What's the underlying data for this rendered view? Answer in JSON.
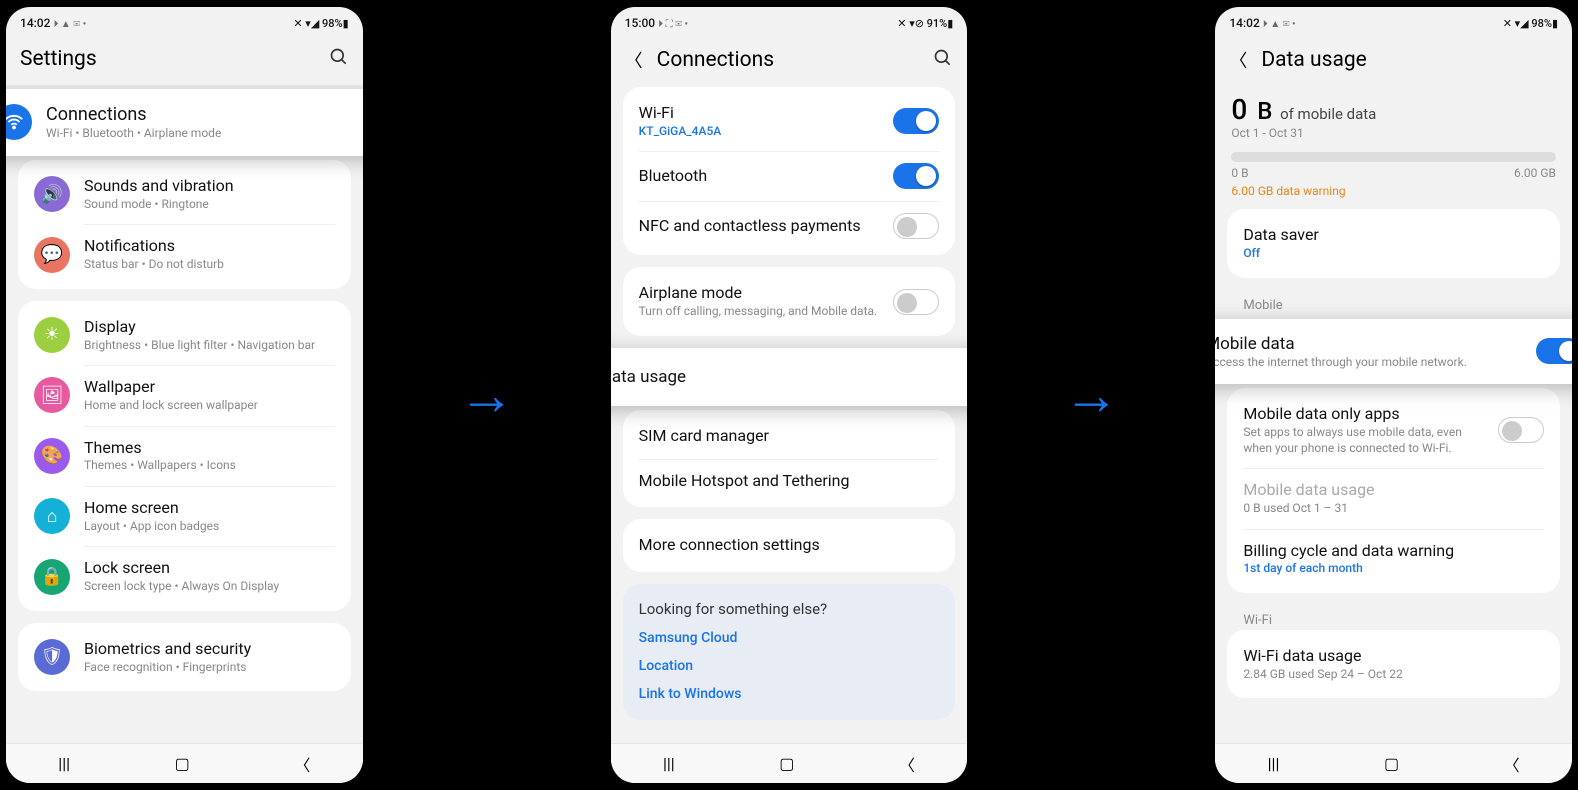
{
  "phone1": {
    "status": {
      "time": "14:02",
      "left_icons": "⏵ ▲ ✉ •",
      "right": "✕ ▾◢ 98%▮"
    },
    "header": {
      "title": "Settings"
    },
    "highlight": {
      "title": "Connections",
      "sub": "Wi-Fi  •  Bluetooth  •  Airplane mode"
    },
    "items": [
      {
        "title": "Sounds and vibration",
        "sub": "Sound mode  •  Ringtone",
        "color": "#8a6bd6",
        "glyph": "🔊"
      },
      {
        "title": "Notifications",
        "sub": "Status bar  •  Do not disturb",
        "color": "#e87561",
        "glyph": "💬"
      },
      {
        "title": "Display",
        "sub": "Brightness  •  Blue light filter  •  Navigation bar",
        "color": "#9bcf3f",
        "glyph": "☀"
      },
      {
        "title": "Wallpaper",
        "sub": "Home and lock screen wallpaper",
        "color": "#e85aa0",
        "glyph": "🖼"
      },
      {
        "title": "Themes",
        "sub": "Themes  •  Wallpapers  •  Icons",
        "color": "#9a5aec",
        "glyph": "🎨"
      },
      {
        "title": "Home screen",
        "sub": "Layout  •  App icon badges",
        "color": "#14b0d6",
        "glyph": "⌂"
      },
      {
        "title": "Lock screen",
        "sub": "Screen lock type  •  Always On Display",
        "color": "#17a673",
        "glyph": "🔒"
      },
      {
        "title": "Biometrics and security",
        "sub": "Face recognition  •  Fingerprints",
        "color": "#5a6bd6",
        "glyph": "🛡"
      }
    ]
  },
  "phone2": {
    "status": {
      "time": "15:00",
      "left_icons": "⏵ ⛶ ✉ •",
      "right": "✕ ▾⊘ 91%▮"
    },
    "header": {
      "title": "Connections"
    },
    "rows1": [
      {
        "title": "Wi-Fi",
        "sub": "KT_GiGA_4A5A",
        "subblue": true,
        "toggle": "on"
      },
      {
        "title": "Bluetooth",
        "toggle": "on"
      },
      {
        "title": "NFC and contactless payments",
        "toggle": "off"
      }
    ],
    "rows2": [
      {
        "title": "Airplane mode",
        "sub": "Turn off calling, messaging, and Mobile data.",
        "toggle": "off"
      }
    ],
    "highlight": {
      "title": "Data usage"
    },
    "rows3": [
      {
        "title": "SIM card manager"
      },
      {
        "title": "Mobile Hotspot and Tethering"
      }
    ],
    "rows4": [
      {
        "title": "More connection settings"
      }
    ],
    "looking": {
      "hdr": "Looking for something else?",
      "links": [
        "Samsung Cloud",
        "Location",
        "Link to Windows"
      ]
    }
  },
  "phone3": {
    "status": {
      "time": "14:02",
      "left_icons": "⏵ ▲ ✉ •",
      "right": "✕ ▾◢ 98%▮"
    },
    "header": {
      "title": "Data usage"
    },
    "usage": {
      "num": "0",
      "unit": "B",
      "of": "of mobile data",
      "range": "Oct 1 - Oct 31",
      "left": "0 B",
      "right": "6.00 GB",
      "warning": "6.00 GB data warning"
    },
    "datasaver": {
      "title": "Data saver",
      "sub": "Off"
    },
    "section_mobile": "Mobile",
    "highlight": {
      "title": "Mobile data",
      "sub": "Access the internet through your mobile network.",
      "toggle": "on"
    },
    "mobile_rows": [
      {
        "title": "Mobile data only apps",
        "sub": "Set apps to always use mobile data, even when your phone is connected to Wi-Fi.",
        "toggle": "off",
        "muted": false
      },
      {
        "title": "Mobile data usage",
        "sub": "0 B used Oct 1 – 31",
        "muted": true
      },
      {
        "title": "Billing cycle and data warning",
        "sub": "1st day of each month",
        "subblue": true
      }
    ],
    "section_wifi": "Wi-Fi",
    "wifi_row": {
      "title": "Wi-Fi data usage",
      "sub": "2.84 GB used Sep 24 – Oct 22"
    }
  }
}
